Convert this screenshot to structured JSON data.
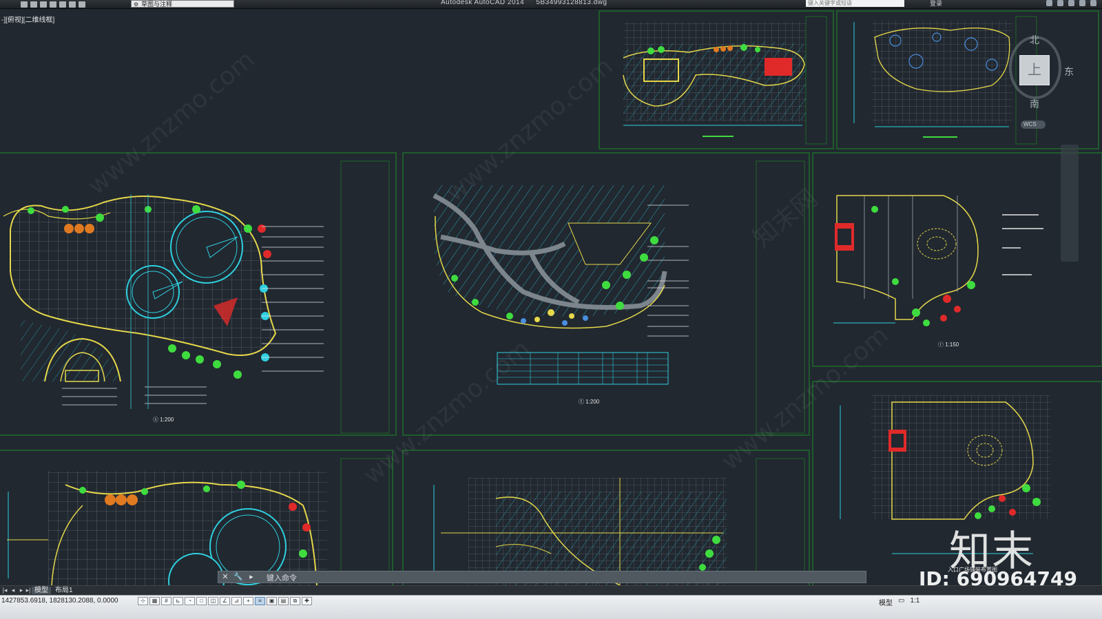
{
  "titlebar": {
    "workspace": "草图与注释",
    "app_name": "Autodesk AutoCAD 2014",
    "file_name": "5B34993128813.dwg",
    "search_placeholder": "键入关键字或短语",
    "login_label": "登录"
  },
  "viewport": {
    "label": "-][俯视][二维线框]"
  },
  "viewcube": {
    "north": "北",
    "south": "南",
    "east": "东",
    "top_face": "上",
    "wcs_label": "WCS"
  },
  "drawings": {
    "plan_scale_a": "1:200",
    "plan_scale_b": "1:200",
    "plan_scale_c": "1:150",
    "bottom_right_title": "入口广场铺装布置图"
  },
  "command": {
    "prompt": "键入命令"
  },
  "tabs": {
    "model": "模型",
    "layout1": "布局1"
  },
  "status": {
    "coordinates": "1427853.6918, 1828130.2088, 0.0000",
    "model_label": "模型",
    "scale": "1:1"
  },
  "watermark": {
    "brand": "知末",
    "id_text": "ID: 690964749",
    "url": "www.znzmo.com",
    "cn": "知末网"
  },
  "colors": {
    "background": "#212830",
    "frame": "#1f5c2a",
    "cyan": "#2fd0e0",
    "yellow": "#e6d84a",
    "red": "#e02a2a",
    "green": "#3fdc3f"
  }
}
